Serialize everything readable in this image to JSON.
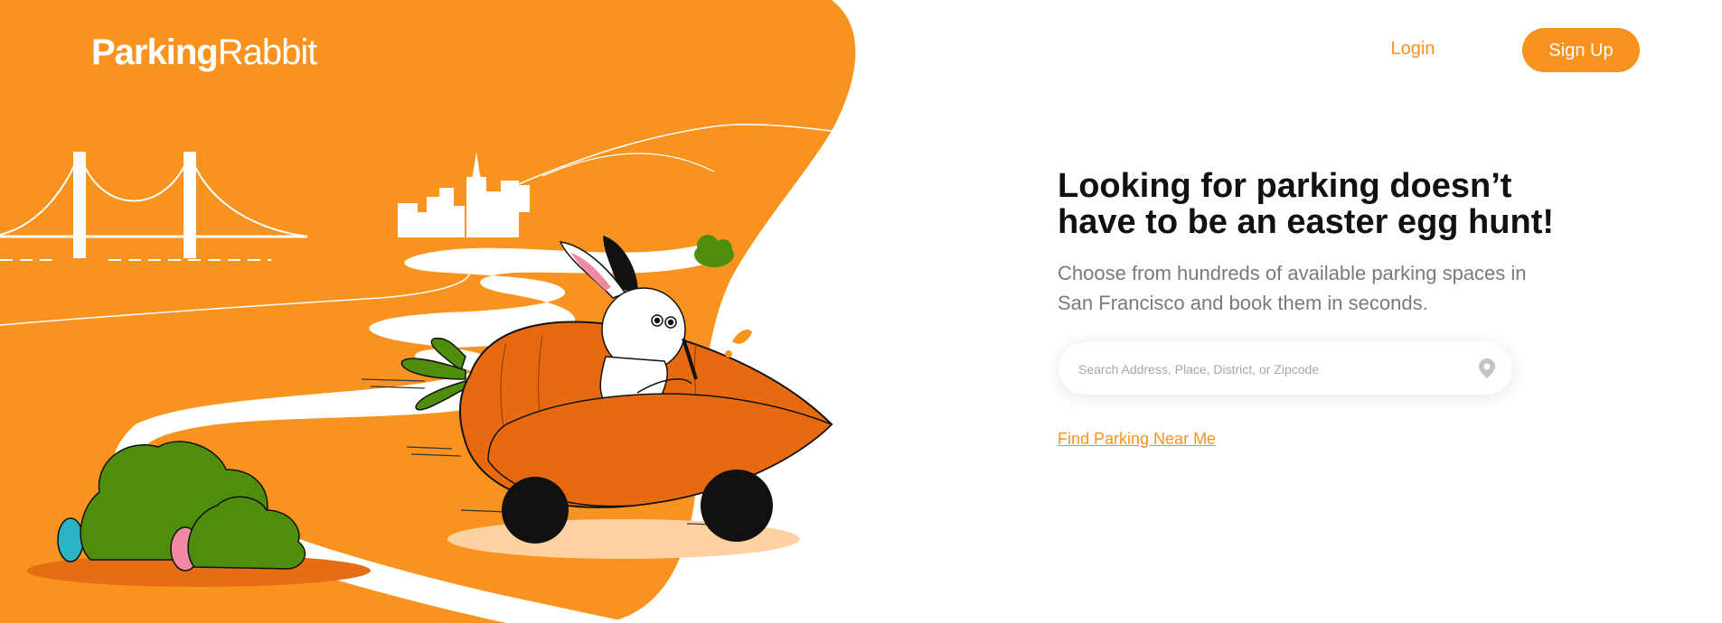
{
  "brand": {
    "name_bold": "Parking",
    "name_light": "Rabbit"
  },
  "nav": {
    "login": "Login",
    "signup": "Sign Up"
  },
  "hero": {
    "headline": "Looking for parking doesn’t have to be an easter egg hunt!",
    "subtext": "Choose from hundreds of available parking spaces in San Francisco and book them in seconds."
  },
  "search": {
    "placeholder": "Search Address, Place, District, or Zipcode",
    "value": "",
    "icon": "location-pin-icon"
  },
  "cta": {
    "find_parking": "Find Parking Near Me"
  },
  "colors": {
    "brand_orange": "#f7931e",
    "car_orange": "#e76a11",
    "bush_green": "#4e8e0c",
    "text_dark": "#111111",
    "text_gray": "#7a7a7a"
  }
}
